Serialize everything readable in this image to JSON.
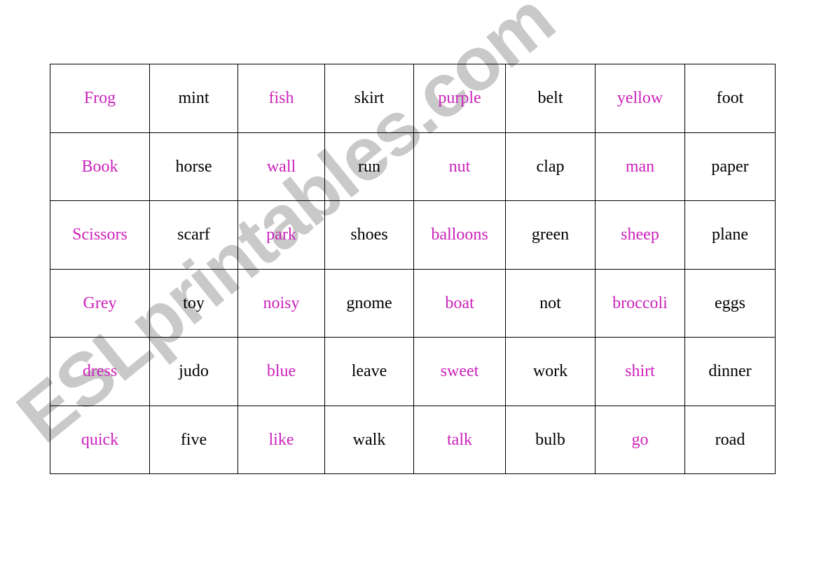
{
  "page": {
    "kind": "vocabulary-word-grid-worksheet",
    "background_color": "#ffffff",
    "border_color": "#000000"
  },
  "watermark": {
    "text": "ESLprintables.com",
    "color": "#c9c9c9",
    "rotation_degrees": -39
  },
  "colors": {
    "magenta": "#cc22bb",
    "black": "#000000",
    "border": "#000000",
    "watermark_gray": "#c9c9c9"
  },
  "grid": {
    "columns": 8,
    "rows": 6,
    "column_color_pattern": [
      "magenta",
      "black",
      "magenta",
      "black",
      "magenta",
      "black",
      "magenta",
      "black"
    ],
    "cells": [
      [
        {
          "text": "Frog",
          "color": "magenta"
        },
        {
          "text": "mint",
          "color": "black"
        },
        {
          "text": "fish",
          "color": "magenta"
        },
        {
          "text": "skirt",
          "color": "black"
        },
        {
          "text": "purple",
          "color": "magenta"
        },
        {
          "text": "belt",
          "color": "black"
        },
        {
          "text": "yellow",
          "color": "magenta"
        },
        {
          "text": "foot",
          "color": "black"
        }
      ],
      [
        {
          "text": "Book",
          "color": "magenta"
        },
        {
          "text": "horse",
          "color": "black"
        },
        {
          "text": "wall",
          "color": "magenta"
        },
        {
          "text": "run",
          "color": "black"
        },
        {
          "text": "nut",
          "color": "magenta"
        },
        {
          "text": "clap",
          "color": "black"
        },
        {
          "text": "man",
          "color": "magenta"
        },
        {
          "text": "paper",
          "color": "black"
        }
      ],
      [
        {
          "text": "Scissors",
          "color": "magenta"
        },
        {
          "text": "scarf",
          "color": "black"
        },
        {
          "text": "park",
          "color": "magenta"
        },
        {
          "text": "shoes",
          "color": "black"
        },
        {
          "text": "balloons",
          "color": "magenta"
        },
        {
          "text": "green",
          "color": "black"
        },
        {
          "text": "sheep",
          "color": "magenta"
        },
        {
          "text": "plane",
          "color": "black"
        }
      ],
      [
        {
          "text": "Grey",
          "color": "magenta"
        },
        {
          "text": "toy",
          "color": "black"
        },
        {
          "text": "noisy",
          "color": "magenta"
        },
        {
          "text": "gnome",
          "color": "black"
        },
        {
          "text": "boat",
          "color": "magenta"
        },
        {
          "text": "not",
          "color": "black"
        },
        {
          "text": "broccoli",
          "color": "magenta"
        },
        {
          "text": "eggs",
          "color": "black"
        }
      ],
      [
        {
          "text": "dress",
          "color": "magenta"
        },
        {
          "text": "judo",
          "color": "black"
        },
        {
          "text": "blue",
          "color": "magenta"
        },
        {
          "text": "leave",
          "color": "black"
        },
        {
          "text": "sweet",
          "color": "magenta"
        },
        {
          "text": "work",
          "color": "black"
        },
        {
          "text": "shirt",
          "color": "magenta"
        },
        {
          "text": "dinner",
          "color": "black"
        }
      ],
      [
        {
          "text": "quick",
          "color": "magenta"
        },
        {
          "text": "five",
          "color": "black"
        },
        {
          "text": "like",
          "color": "magenta"
        },
        {
          "text": "walk",
          "color": "black"
        },
        {
          "text": "talk",
          "color": "magenta"
        },
        {
          "text": "bulb",
          "color": "black"
        },
        {
          "text": "go",
          "color": "magenta"
        },
        {
          "text": "road",
          "color": "black"
        }
      ]
    ]
  }
}
